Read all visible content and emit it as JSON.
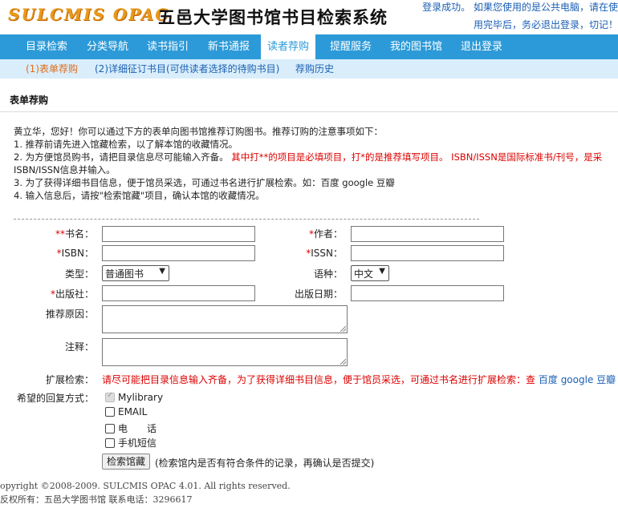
{
  "header": {
    "logo": "SULCMIS OPAC",
    "title": "五邑大学图书馆书目检索系统",
    "login_line1": "登录成功。 如果您使用的是公共电脑，请在使",
    "login_line2": "用完毕后，务必退出登录，切记！"
  },
  "nav": {
    "items": [
      "目录检索",
      "分类导航",
      "读书指引",
      "新书通报",
      "读者荐购",
      "提醒服务",
      "我的图书馆",
      "退出登录"
    ],
    "active_index": 4
  },
  "subnav": {
    "items": [
      "(1)表单荐购",
      "(2)详细征订书目(可供读者选择的待购书目)",
      "荐购历史"
    ],
    "active_index": 0
  },
  "section_title": "表单荐购",
  "notes": {
    "line0": "黄立华，您好！你可以通过下方的表单向图书馆推荐订购图书。推荐订购的注意事项如下：",
    "line1": "1. 推荐前请先进入馆藏检索，以了解本馆的收藏情况。",
    "line2a": "2. 为方便馆员购书，请把目录信息尽可能输入齐备。",
    "line2b": "其中打**的项目是必填项目，打*的是推荐填写项目。 ISBN/ISSN是国际标准书/刊号，是采",
    "line2c": "ISBN/ISSN信息并输入。",
    "line3": "3. 为了获得详细书目信息，便于馆员采选，可通过书名进行扩展检索。如：百度 google 豆瓣",
    "line4": "4. 输入信息后，请按\"检索馆藏\"项目，确认本馆的收藏情况。"
  },
  "form": {
    "title_req": "**",
    "title_label": "书名：",
    "author_req": "*",
    "author_label": "作者：",
    "isbn_req": "*",
    "isbn_label": "ISBN：",
    "issn_req": "*",
    "issn_label": "ISSN：",
    "type_label": "类型：",
    "type_value": "普通图书",
    "lang_label": "语种：",
    "lang_value": "中文",
    "publisher_req": "*",
    "publisher_label": "出版社：",
    "pubdate_label": "出版日期：",
    "reason_label": "推荐原因：",
    "note_label": "注释：",
    "ext_label": "扩展检索：",
    "ext_text": "请尽可能把目录信息输入齐备，为了获得详细书目信息，便于馆员采选，可通过书名进行扩展检索：查",
    "ext_links": [
      "百度",
      "google",
      "豆瓣"
    ],
    "reply_label": "希望的回复方式：",
    "reply_options": [
      "Mylibrary",
      "EMAIL",
      "电　　话",
      "手机短信"
    ],
    "search_button": "检索馆藏",
    "search_note": "(检索馆内是否有符合条件的记录，再确认是否提交)"
  },
  "footer": {
    "line1": "opyright ©2008-2009. SULCMIS OPAC 4.01. All rights reserved.",
    "line2": "反权所有：五邑大学图书馆 联系电话：3296617"
  }
}
